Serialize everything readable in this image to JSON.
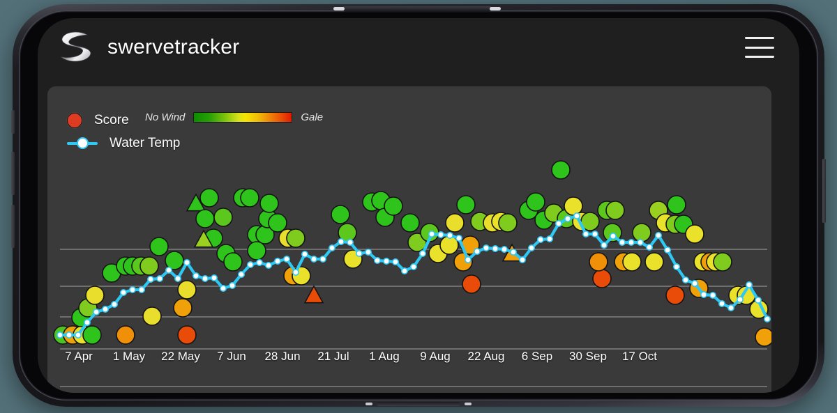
{
  "header": {
    "title": "swervetracker",
    "logo_icon": "swerve-s-logo-icon",
    "menu_icon": "hamburger-menu-icon"
  },
  "legend": {
    "score_label": "Score",
    "score_color": "#dd3b22",
    "temp_label": "Water Temp",
    "temp_color": "#2ec8f5",
    "wind_low_label": "No Wind",
    "wind_high_label": "Gale",
    "wind_low_color": "#0d8c00",
    "wind_mid_color": "#f5e500",
    "wind_high_color": "#e01b00"
  },
  "chart_data": {
    "type": "scatter",
    "title": "",
    "subtitle": "",
    "xlabel": "",
    "ylabel": "",
    "grid": true,
    "gridlines_y": [
      234,
      287,
      331,
      377,
      431
    ],
    "legend_position": "top-left",
    "xlim": [
      0,
      1038
    ],
    "ylim": [
      0,
      442
    ],
    "x_tick_labels": [
      "7 Apr",
      "1 May",
      "22 May",
      "7 Jun",
      "28 Jun",
      "21 Jul",
      "1 Aug",
      "9 Aug",
      "22 Aug",
      "6 Sep",
      "30 Sep",
      "17 Oct"
    ],
    "x_tick_positions": [
      31,
      103,
      177,
      250,
      323,
      396,
      469,
      542,
      615,
      688,
      761,
      835
    ],
    "series": [
      {
        "name": "Water Temp",
        "type": "line",
        "color": "#2ec8f5",
        "marker": "circle-white",
        "points": [
          [
            18,
            357
          ],
          [
            31,
            357
          ],
          [
            44,
            357
          ],
          [
            57,
            339
          ],
          [
            70,
            324
          ],
          [
            83,
            320
          ],
          [
            96,
            313
          ],
          [
            109,
            296
          ],
          [
            122,
            292
          ],
          [
            135,
            292
          ],
          [
            148,
            277
          ],
          [
            161,
            276
          ],
          [
            174,
            264
          ],
          [
            187,
            276
          ],
          [
            200,
            253
          ],
          [
            213,
            272
          ],
          [
            226,
            276
          ],
          [
            239,
            275
          ],
          [
            252,
            290
          ],
          [
            265,
            286
          ],
          [
            278,
            270
          ],
          [
            291,
            256
          ],
          [
            304,
            253
          ],
          [
            317,
            257
          ],
          [
            330,
            251
          ],
          [
            343,
            248
          ],
          [
            356,
            267
          ],
          [
            369,
            241
          ],
          [
            382,
            248
          ],
          [
            395,
            248
          ],
          [
            408,
            232
          ],
          [
            421,
            223
          ],
          [
            434,
            224
          ],
          [
            447,
            240
          ],
          [
            460,
            238
          ],
          [
            473,
            250
          ],
          [
            486,
            251
          ],
          [
            499,
            252
          ],
          [
            512,
            265
          ],
          [
            525,
            259
          ],
          [
            538,
            240
          ],
          [
            551,
            212
          ],
          [
            564,
            213
          ],
          [
            577,
            214
          ],
          [
            590,
            218
          ],
          [
            603,
            249
          ],
          [
            616,
            237
          ],
          [
            629,
            232
          ],
          [
            642,
            233
          ],
          [
            655,
            234
          ],
          [
            668,
            238
          ],
          [
            681,
            249
          ],
          [
            694,
            232
          ],
          [
            707,
            220
          ],
          [
            720,
            219
          ],
          [
            733,
            197
          ],
          [
            746,
            190
          ],
          [
            759,
            186
          ],
          [
            772,
            212
          ],
          [
            785,
            212
          ],
          [
            798,
            228
          ],
          [
            811,
            215
          ],
          [
            824,
            224
          ],
          [
            837,
            224
          ],
          [
            850,
            224
          ],
          [
            863,
            231
          ],
          [
            876,
            214
          ],
          [
            889,
            235
          ],
          [
            902,
            259
          ],
          [
            915,
            278
          ],
          [
            928,
            283
          ],
          [
            941,
            299
          ],
          [
            954,
            300
          ],
          [
            967,
            312
          ],
          [
            980,
            318
          ],
          [
            993,
            306
          ],
          [
            1006,
            285
          ],
          [
            1019,
            307
          ],
          [
            1032,
            334
          ]
        ]
      },
      {
        "name": "Score",
        "type": "bubble",
        "note": "wind-colored markers; shape circle or triangle",
        "points": [
          {
            "x": 22,
            "y": 357,
            "c": "#4ec424",
            "s": "circle"
          },
          {
            "x": 36,
            "y": 357,
            "c": "#f0a008",
            "s": "circle"
          },
          {
            "x": 50,
            "y": 357,
            "c": "#eae12a",
            "s": "circle"
          },
          {
            "x": 64,
            "y": 357,
            "c": "#2fc41b",
            "s": "circle"
          },
          {
            "x": 48,
            "y": 332,
            "c": "#2fc41b",
            "s": "circle"
          },
          {
            "x": 58,
            "y": 318,
            "c": "#7fcc1f",
            "s": "circle"
          },
          {
            "x": 68,
            "y": 300,
            "c": "#e8de2b",
            "s": "circle"
          },
          {
            "x": 92,
            "y": 268,
            "c": "#2fc41b",
            "s": "circle"
          },
          {
            "x": 112,
            "y": 258,
            "c": "#2fc41b",
            "s": "circle"
          },
          {
            "x": 122,
            "y": 258,
            "c": "#2fc41b",
            "s": "circle"
          },
          {
            "x": 134,
            "y": 258,
            "c": "#5cc81e",
            "s": "circle"
          },
          {
            "x": 146,
            "y": 258,
            "c": "#7fcc1f",
            "s": "circle"
          },
          {
            "x": 112,
            "y": 357,
            "c": "#f09008",
            "s": "circle"
          },
          {
            "x": 150,
            "y": 330,
            "c": "#e8de2b",
            "s": "circle"
          },
          {
            "x": 160,
            "y": 230,
            "c": "#2fc41b",
            "s": "circle"
          },
          {
            "x": 182,
            "y": 250,
            "c": "#2fc41b",
            "s": "circle"
          },
          {
            "x": 194,
            "y": 318,
            "c": "#f0a008",
            "s": "circle"
          },
          {
            "x": 200,
            "y": 292,
            "c": "#e8de2b",
            "s": "circle"
          },
          {
            "x": 200,
            "y": 357,
            "c": "#e84c08",
            "s": "circle"
          },
          {
            "x": 213,
            "y": 168,
            "c": "#2fc41b",
            "s": "triangle"
          },
          {
            "x": 232,
            "y": 160,
            "c": "#2fc41b",
            "s": "circle"
          },
          {
            "x": 226,
            "y": 190,
            "c": "#2fc41b",
            "s": "circle"
          },
          {
            "x": 252,
            "y": 188,
            "c": "#5cc81e",
            "s": "circle"
          },
          {
            "x": 256,
            "y": 240,
            "c": "#2fc41b",
            "s": "circle"
          },
          {
            "x": 238,
            "y": 218,
            "c": "#2fc41b",
            "s": "circle"
          },
          {
            "x": 266,
            "y": 252,
            "c": "#2fc41b",
            "s": "circle"
          },
          {
            "x": 300,
            "y": 213,
            "c": "#2fc41b",
            "s": "circle"
          },
          {
            "x": 312,
            "y": 213,
            "c": "#2fc41b",
            "s": "circle"
          },
          {
            "x": 316,
            "y": 190,
            "c": "#2fc41b",
            "s": "circle"
          },
          {
            "x": 300,
            "y": 236,
            "c": "#2fc41b",
            "s": "circle"
          },
          {
            "x": 330,
            "y": 196,
            "c": "#2fc41b",
            "s": "circle"
          },
          {
            "x": 318,
            "y": 168,
            "c": "#2fc41b",
            "s": "circle"
          },
          {
            "x": 280,
            "y": 160,
            "c": "#2fc41b",
            "s": "circle"
          },
          {
            "x": 290,
            "y": 160,
            "c": "#2fc41b",
            "s": "circle"
          },
          {
            "x": 224,
            "y": 220,
            "c": "#9ad020",
            "s": "triangle"
          },
          {
            "x": 345,
            "y": 218,
            "c": "#e8de2b",
            "s": "circle"
          },
          {
            "x": 356,
            "y": 218,
            "c": "#7fcc1f",
            "s": "circle"
          },
          {
            "x": 352,
            "y": 272,
            "c": "#f0a008",
            "s": "circle"
          },
          {
            "x": 364,
            "y": 272,
            "c": "#eae12a",
            "s": "circle"
          },
          {
            "x": 382,
            "y": 300,
            "c": "#e84c08",
            "s": "triangle"
          },
          {
            "x": 420,
            "y": 184,
            "c": "#2fc41b",
            "s": "circle"
          },
          {
            "x": 430,
            "y": 210,
            "c": "#5cc81e",
            "s": "circle"
          },
          {
            "x": 438,
            "y": 248,
            "c": "#eae12a",
            "s": "circle"
          },
          {
            "x": 465,
            "y": 166,
            "c": "#2fc41b",
            "s": "circle"
          },
          {
            "x": 478,
            "y": 164,
            "c": "#2fc41b",
            "s": "circle"
          },
          {
            "x": 484,
            "y": 188,
            "c": "#2fc41b",
            "s": "circle"
          },
          {
            "x": 496,
            "y": 172,
            "c": "#2fc41b",
            "s": "circle"
          },
          {
            "x": 520,
            "y": 196,
            "c": "#2fc41b",
            "s": "circle"
          },
          {
            "x": 530,
            "y": 224,
            "c": "#7fcc1f",
            "s": "circle"
          },
          {
            "x": 548,
            "y": 210,
            "c": "#5cc81e",
            "s": "circle"
          },
          {
            "x": 560,
            "y": 240,
            "c": "#eae12a",
            "s": "circle"
          },
          {
            "x": 576,
            "y": 228,
            "c": "#eae12a",
            "s": "circle"
          },
          {
            "x": 584,
            "y": 196,
            "c": "#e8de2b",
            "s": "circle"
          },
          {
            "x": 596,
            "y": 252,
            "c": "#f0a008",
            "s": "circle"
          },
          {
            "x": 608,
            "y": 284,
            "c": "#e84c08",
            "s": "circle"
          },
          {
            "x": 606,
            "y": 228,
            "c": "#f0a008",
            "s": "circle"
          },
          {
            "x": 600,
            "y": 170,
            "c": "#2fc41b",
            "s": "circle"
          },
          {
            "x": 620,
            "y": 194,
            "c": "#7fcc1f",
            "s": "circle"
          },
          {
            "x": 638,
            "y": 196,
            "c": "#e8de2b",
            "s": "circle"
          },
          {
            "x": 650,
            "y": 194,
            "c": "#eae12a",
            "s": "circle"
          },
          {
            "x": 660,
            "y": 196,
            "c": "#7fcc1f",
            "s": "circle"
          },
          {
            "x": 666,
            "y": 240,
            "c": "#f0a008",
            "s": "triangle"
          },
          {
            "x": 690,
            "y": 178,
            "c": "#2fc41b",
            "s": "circle"
          },
          {
            "x": 700,
            "y": 166,
            "c": "#2fc41b",
            "s": "circle"
          },
          {
            "x": 712,
            "y": 192,
            "c": "#2fc41b",
            "s": "circle"
          },
          {
            "x": 726,
            "y": 182,
            "c": "#7fcc1f",
            "s": "circle"
          },
          {
            "x": 736,
            "y": 120,
            "c": "#2fc41b",
            "s": "circle"
          },
          {
            "x": 744,
            "y": 190,
            "c": "#5cc81e",
            "s": "circle"
          },
          {
            "x": 754,
            "y": 172,
            "c": "#eae12a",
            "s": "circle"
          },
          {
            "x": 766,
            "y": 194,
            "c": "#eae12a",
            "s": "circle"
          },
          {
            "x": 778,
            "y": 194,
            "c": "#7fcc1f",
            "s": "circle"
          },
          {
            "x": 795,
            "y": 276,
            "c": "#e84c08",
            "s": "circle"
          },
          {
            "x": 790,
            "y": 252,
            "c": "#f09008",
            "s": "circle"
          },
          {
            "x": 802,
            "y": 178,
            "c": "#5cc81e",
            "s": "circle"
          },
          {
            "x": 814,
            "y": 178,
            "c": "#7fcc1f",
            "s": "circle"
          },
          {
            "x": 810,
            "y": 210,
            "c": "#5cc81e",
            "s": "circle"
          },
          {
            "x": 826,
            "y": 252,
            "c": "#f0a008",
            "s": "circle"
          },
          {
            "x": 838,
            "y": 252,
            "c": "#eae12a",
            "s": "circle"
          },
          {
            "x": 852,
            "y": 210,
            "c": "#7fcc1f",
            "s": "circle"
          },
          {
            "x": 870,
            "y": 252,
            "c": "#eae12a",
            "s": "circle"
          },
          {
            "x": 876,
            "y": 178,
            "c": "#9ad020",
            "s": "circle"
          },
          {
            "x": 886,
            "y": 196,
            "c": "#eae12a",
            "s": "circle"
          },
          {
            "x": 900,
            "y": 198,
            "c": "#7fcc1f",
            "s": "circle"
          },
          {
            "x": 912,
            "y": 198,
            "c": "#2fc41b",
            "s": "circle"
          },
          {
            "x": 902,
            "y": 170,
            "c": "#2fc41b",
            "s": "circle"
          },
          {
            "x": 928,
            "y": 212,
            "c": "#eae12a",
            "s": "circle"
          },
          {
            "x": 940,
            "y": 252,
            "c": "#eae12a",
            "s": "circle"
          },
          {
            "x": 950,
            "y": 252,
            "c": "#f0a008",
            "s": "circle"
          },
          {
            "x": 958,
            "y": 252,
            "c": "#eae12a",
            "s": "circle"
          },
          {
            "x": 968,
            "y": 252,
            "c": "#7fcc1f",
            "s": "circle"
          },
          {
            "x": 934,
            "y": 290,
            "c": "#f0a008",
            "s": "circle"
          },
          {
            "x": 900,
            "y": 300,
            "c": "#e84c08",
            "s": "circle"
          },
          {
            "x": 990,
            "y": 300,
            "c": "#eae12a",
            "s": "circle"
          },
          {
            "x": 1002,
            "y": 300,
            "c": "#eae12a",
            "s": "circle"
          },
          {
            "x": 1020,
            "y": 320,
            "c": "#eae12a",
            "s": "circle"
          },
          {
            "x": 1028,
            "y": 360,
            "c": "#f0a008",
            "s": "circle"
          }
        ]
      }
    ]
  }
}
